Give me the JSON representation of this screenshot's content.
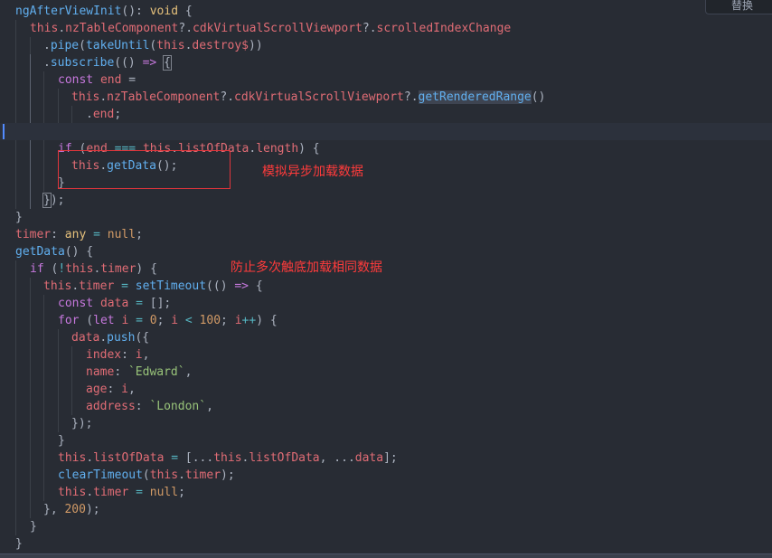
{
  "widget": {
    "label": "替换"
  },
  "annotations": {
    "async_load": "模拟异步加载数据",
    "avoid_repeat": "防止多次触底加载相同数据"
  },
  "lines": [
    {
      "indent": 0,
      "tokens": [
        [
          "f",
          "ngAfterViewInit"
        ],
        [
          "d",
          "(): "
        ],
        [
          "t",
          "void"
        ],
        [
          "d",
          " {"
        ]
      ]
    },
    {
      "indent": 1,
      "tokens": [
        [
          "p",
          "this"
        ],
        [
          "d",
          "."
        ],
        [
          "p",
          "nzTableComponent"
        ],
        [
          "d",
          "?."
        ],
        [
          "p",
          "cdkVirtualScrollViewport"
        ],
        [
          "d",
          "?."
        ],
        [
          "p",
          "scrolledIndexChange"
        ]
      ]
    },
    {
      "indent": 2,
      "tokens": [
        [
          "d",
          "."
        ],
        [
          "f",
          "pipe"
        ],
        [
          "d",
          "("
        ],
        [
          "f",
          "takeUntil"
        ],
        [
          "d",
          "("
        ],
        [
          "p",
          "this"
        ],
        [
          "d",
          "."
        ],
        [
          "p",
          "destroy$"
        ],
        [
          "d",
          "))"
        ]
      ]
    },
    {
      "indent": 2,
      "tokens": [
        [
          "d",
          "."
        ],
        [
          "f",
          "subscribe"
        ],
        [
          "d",
          "(() "
        ],
        [
          "k",
          "=>"
        ],
        [
          "d",
          " "
        ],
        [
          "match",
          "{"
        ]
      ]
    },
    {
      "indent": 3,
      "tokens": [
        [
          "k",
          "const"
        ],
        [
          "d",
          " "
        ],
        [
          "p",
          "end"
        ],
        [
          "d",
          " ="
        ]
      ]
    },
    {
      "indent": 4,
      "tokens": [
        [
          "p",
          "this"
        ],
        [
          "d",
          "."
        ],
        [
          "p",
          "nzTableComponent"
        ],
        [
          "d",
          "?."
        ],
        [
          "p",
          "cdkVirtualScrollViewport"
        ],
        [
          "d",
          "?."
        ],
        [
          "rhl",
          "getRenderedRange"
        ],
        [
          "d",
          "()"
        ]
      ]
    },
    {
      "indent": 5,
      "tokens": [
        [
          "d",
          "."
        ],
        [
          "p",
          "end"
        ],
        [
          "d",
          ";"
        ]
      ]
    },
    {
      "indent": 0,
      "active": true,
      "tokens": []
    },
    {
      "indent": 3,
      "tokens": [
        [
          "k",
          "if"
        ],
        [
          "d",
          " ("
        ],
        [
          "p",
          "end"
        ],
        [
          "d",
          " "
        ],
        [
          "o",
          "==="
        ],
        [
          "d",
          " "
        ],
        [
          "p",
          "this"
        ],
        [
          "d",
          "."
        ],
        [
          "p",
          "listOfData"
        ],
        [
          "d",
          "."
        ],
        [
          "p",
          "length"
        ],
        [
          "d",
          ") {"
        ]
      ]
    },
    {
      "indent": 4,
      "tokens": [
        [
          "p",
          "this"
        ],
        [
          "d",
          "."
        ],
        [
          "f",
          "getData"
        ],
        [
          "d",
          "();"
        ]
      ]
    },
    {
      "indent": 3,
      "tokens": [
        [
          "d",
          "}"
        ]
      ]
    },
    {
      "indent": 2,
      "tokens": [
        [
          "match",
          "}"
        ],
        [
          "d",
          ");"
        ]
      ]
    },
    {
      "indent": 0,
      "tokens": [
        [
          "d",
          "}"
        ]
      ]
    },
    {
      "indent": 0,
      "tokens": [
        [
          "p",
          "timer"
        ],
        [
          "d",
          ": "
        ],
        [
          "t",
          "any"
        ],
        [
          "d",
          " "
        ],
        [
          "o",
          "="
        ],
        [
          "d",
          " "
        ],
        [
          "n",
          "null"
        ],
        [
          "d",
          ";"
        ]
      ]
    },
    {
      "indent": 0,
      "tokens": [
        [
          "f",
          "getData"
        ],
        [
          "d",
          "() {"
        ]
      ]
    },
    {
      "indent": 1,
      "tokens": [
        [
          "k",
          "if"
        ],
        [
          "d",
          " ("
        ],
        [
          "o",
          "!"
        ],
        [
          "p",
          "this"
        ],
        [
          "d",
          "."
        ],
        [
          "p",
          "timer"
        ],
        [
          "d",
          ") {"
        ]
      ]
    },
    {
      "indent": 2,
      "tokens": [
        [
          "p",
          "this"
        ],
        [
          "d",
          "."
        ],
        [
          "p",
          "timer"
        ],
        [
          "d",
          " "
        ],
        [
          "o",
          "="
        ],
        [
          "d",
          " "
        ],
        [
          "f",
          "setTimeout"
        ],
        [
          "d",
          "(() "
        ],
        [
          "k",
          "=>"
        ],
        [
          "d",
          " {"
        ]
      ]
    },
    {
      "indent": 3,
      "tokens": [
        [
          "k",
          "const"
        ],
        [
          "d",
          " "
        ],
        [
          "p",
          "data"
        ],
        [
          "d",
          " "
        ],
        [
          "o",
          "="
        ],
        [
          "d",
          " [];"
        ]
      ]
    },
    {
      "indent": 3,
      "tokens": [
        [
          "k",
          "for"
        ],
        [
          "d",
          " ("
        ],
        [
          "k",
          "let"
        ],
        [
          "d",
          " "
        ],
        [
          "p",
          "i"
        ],
        [
          "d",
          " "
        ],
        [
          "o",
          "="
        ],
        [
          "d",
          " "
        ],
        [
          "n",
          "0"
        ],
        [
          "d",
          "; "
        ],
        [
          "p",
          "i"
        ],
        [
          "d",
          " "
        ],
        [
          "o",
          "<"
        ],
        [
          "d",
          " "
        ],
        [
          "n",
          "100"
        ],
        [
          "d",
          "; "
        ],
        [
          "p",
          "i"
        ],
        [
          "o",
          "++"
        ],
        [
          "d",
          ") {"
        ]
      ]
    },
    {
      "indent": 4,
      "tokens": [
        [
          "p",
          "data"
        ],
        [
          "d",
          "."
        ],
        [
          "f",
          "push"
        ],
        [
          "d",
          "({"
        ]
      ]
    },
    {
      "indent": 5,
      "tokens": [
        [
          "p",
          "index"
        ],
        [
          "d",
          ": "
        ],
        [
          "p",
          "i"
        ],
        [
          "d",
          ","
        ]
      ]
    },
    {
      "indent": 5,
      "tokens": [
        [
          "p",
          "name"
        ],
        [
          "d",
          ": "
        ],
        [
          "s",
          "`Edward`"
        ],
        [
          "d",
          ","
        ]
      ]
    },
    {
      "indent": 5,
      "tokens": [
        [
          "p",
          "age"
        ],
        [
          "d",
          ": "
        ],
        [
          "p",
          "i"
        ],
        [
          "d",
          ","
        ]
      ]
    },
    {
      "indent": 5,
      "tokens": [
        [
          "p",
          "address"
        ],
        [
          "d",
          ": "
        ],
        [
          "s",
          "`London`"
        ],
        [
          "d",
          ","
        ]
      ]
    },
    {
      "indent": 4,
      "tokens": [
        [
          "d",
          "});"
        ]
      ]
    },
    {
      "indent": 3,
      "tokens": [
        [
          "d",
          "}"
        ]
      ]
    },
    {
      "indent": 3,
      "tokens": [
        [
          "p",
          "this"
        ],
        [
          "d",
          "."
        ],
        [
          "p",
          "listOfData"
        ],
        [
          "d",
          " "
        ],
        [
          "o",
          "="
        ],
        [
          "d",
          " [..."
        ],
        [
          "p",
          "this"
        ],
        [
          "d",
          "."
        ],
        [
          "p",
          "listOfData"
        ],
        [
          "d",
          ", ..."
        ],
        [
          "p",
          "data"
        ],
        [
          "d",
          "];"
        ]
      ]
    },
    {
      "indent": 3,
      "tokens": [
        [
          "f",
          "clearTimeout"
        ],
        [
          "d",
          "("
        ],
        [
          "p",
          "this"
        ],
        [
          "d",
          "."
        ],
        [
          "p",
          "timer"
        ],
        [
          "d",
          ");"
        ]
      ]
    },
    {
      "indent": 3,
      "tokens": [
        [
          "p",
          "this"
        ],
        [
          "d",
          "."
        ],
        [
          "p",
          "timer"
        ],
        [
          "d",
          " "
        ],
        [
          "o",
          "="
        ],
        [
          "d",
          " "
        ],
        [
          "n",
          "null"
        ],
        [
          "d",
          ";"
        ]
      ]
    },
    {
      "indent": 2,
      "tokens": [
        [
          "d",
          "}, "
        ],
        [
          "n",
          "200"
        ],
        [
          "d",
          ");"
        ]
      ]
    },
    {
      "indent": 1,
      "tokens": [
        [
          "d",
          "}"
        ]
      ]
    },
    {
      "indent": 0,
      "tokens": [
        [
          "d",
          "}"
        ]
      ]
    }
  ]
}
